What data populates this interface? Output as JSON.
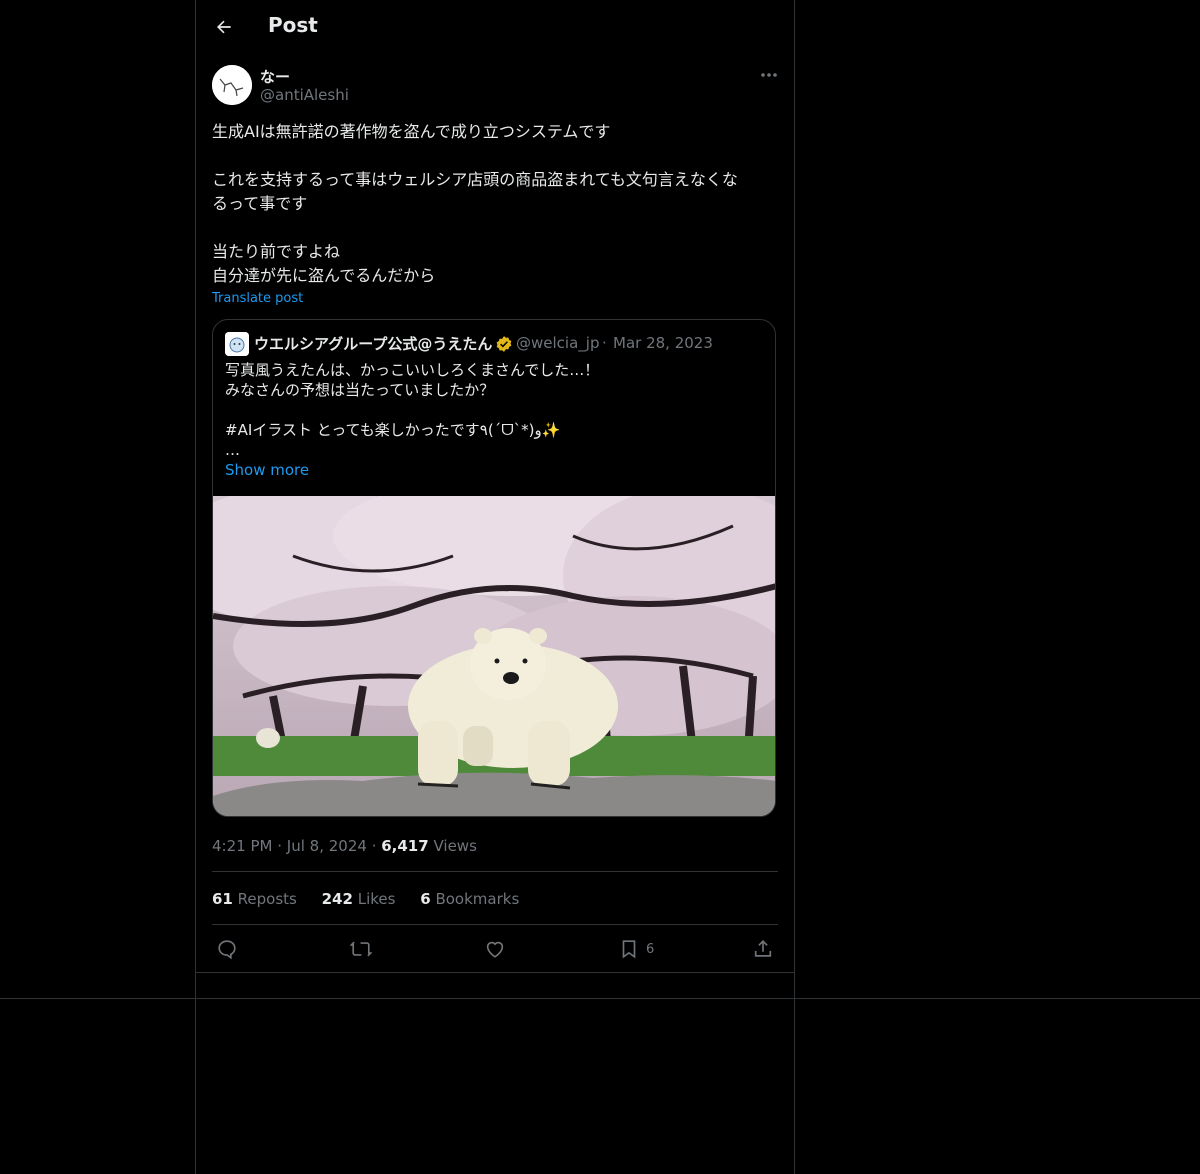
{
  "header": {
    "title": "Post"
  },
  "post": {
    "author_name": "なー",
    "author_handle": "@antiAleshi",
    "text": "生成AIは無許諾の著作物を盗んで成り立つシステムです\n\nこれを支持するって事はウェルシア店頭の商品盗まれても文句言えなくな\nるって事です\n\n当たり前ですよね\n自分達が先に盗んでるんだから",
    "translate_label": "Translate post",
    "time": "4:21 PM",
    "date": "Jul 8, 2024",
    "views_count": "6,417",
    "views_label": "Views",
    "reposts_count": "61",
    "reposts_label": "Reposts",
    "likes_count": "242",
    "likes_label": "Likes",
    "bookmarks_count": "6",
    "bookmarks_label": "Bookmarks",
    "action_bookmark_count": "6"
  },
  "quote": {
    "author_name": "ウエルシアグループ公式@うえたん",
    "author_handle": "@welcia_jp",
    "date": "Mar 28, 2023",
    "text": "写真風うえたんは、かっこいいしろくまさんでした…！\nみなさんの予想は当たっていましたか？\n\n#AIイラスト とっても楽しかったです٩(ˊᗜˋ*)و✨\n…",
    "show_more_label": "Show more"
  },
  "icons": {
    "back": "arrow-left-icon",
    "more": "more-horizontal-icon",
    "verified": "verified-badge-icon",
    "reply": "reply-icon",
    "repost": "repost-icon",
    "like": "heart-icon",
    "bookmark": "bookmark-icon",
    "share": "share-icon"
  },
  "colors": {
    "background": "#000000",
    "text": "#e7e9ea",
    "secondary": "#71767b",
    "link": "#1d9bf0",
    "border": "#2f3336",
    "verified": "#e2b719"
  }
}
